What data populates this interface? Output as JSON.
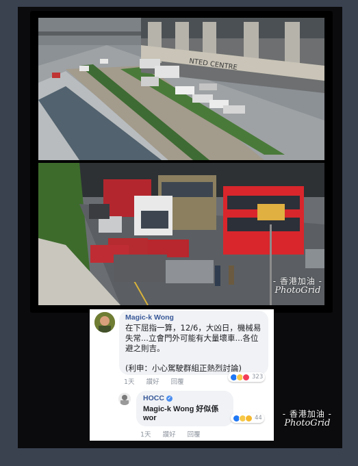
{
  "watermark": {
    "chinese": "- 香港加油 -",
    "english": "PhotoGrid"
  },
  "photo_top": {
    "building_sign": "NTED  CENTRE"
  },
  "comment_1": {
    "author": "Magic-k Wong",
    "text": "在下屈指一算，12/6，大凶日，機械易失常...立會門外可能有大量壞車...各位避之則吉。",
    "text2": "(利申：小心駕駛群組正熱烈討論)",
    "time": "1天",
    "like_label": "讚好",
    "reply_label": "回覆",
    "reaction_count": "323",
    "reactions": [
      "like-icon",
      "haha-icon",
      "love-icon"
    ]
  },
  "comment_2": {
    "author": "HOCC",
    "verified": "✓",
    "text": "Magic-k Wong 好似係 wor",
    "time": "1天",
    "like_label": "讚好",
    "reply_label": "回覆",
    "reaction_count": "44",
    "reactions": [
      "like-icon",
      "haha-icon",
      "wow-icon"
    ]
  },
  "colors": {
    "background": "#3a4250",
    "name_link": "#385898",
    "bubble": "#f0f2f5",
    "like_blue": "#2078f4",
    "love_red": "#f33e58"
  }
}
